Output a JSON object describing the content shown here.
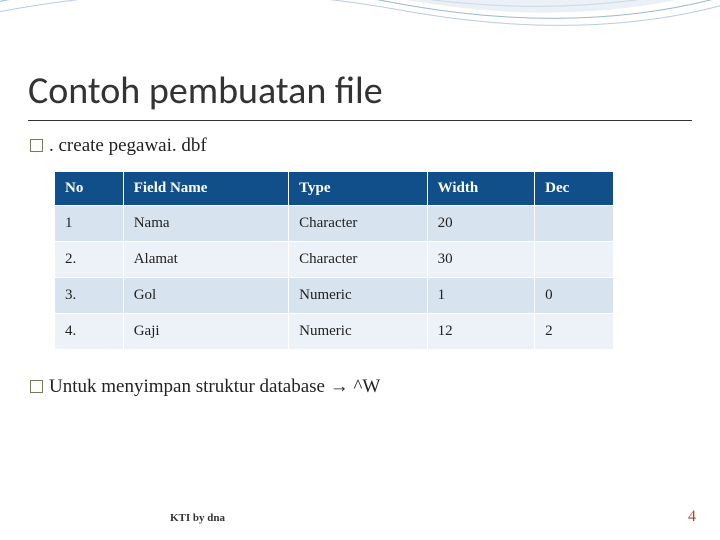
{
  "title": "Contoh pembuatan file",
  "subtitle": ". create pegawai. dbf",
  "table": {
    "headers": [
      "No",
      "Field Name",
      "Type",
      "Width",
      "Dec"
    ],
    "rows": [
      {
        "no": "1",
        "field": "Nama",
        "type": "Character",
        "width": "20",
        "dec": ""
      },
      {
        "no": "2.",
        "field": "Alamat",
        "type": "Character",
        "width": "30",
        "dec": ""
      },
      {
        "no": "3.",
        "field": "Gol",
        "type": "Numeric",
        "width": "1",
        "dec": "0"
      },
      {
        "no": "4.",
        "field": "Gaji",
        "type": "Numeric",
        "width": "12",
        "dec": "2"
      }
    ]
  },
  "note_prefix": "Untuk menyimpan struktur database ",
  "note_arrow": "→",
  "note_suffix": " ^W",
  "footer": "KTI by dna",
  "page": "4"
}
